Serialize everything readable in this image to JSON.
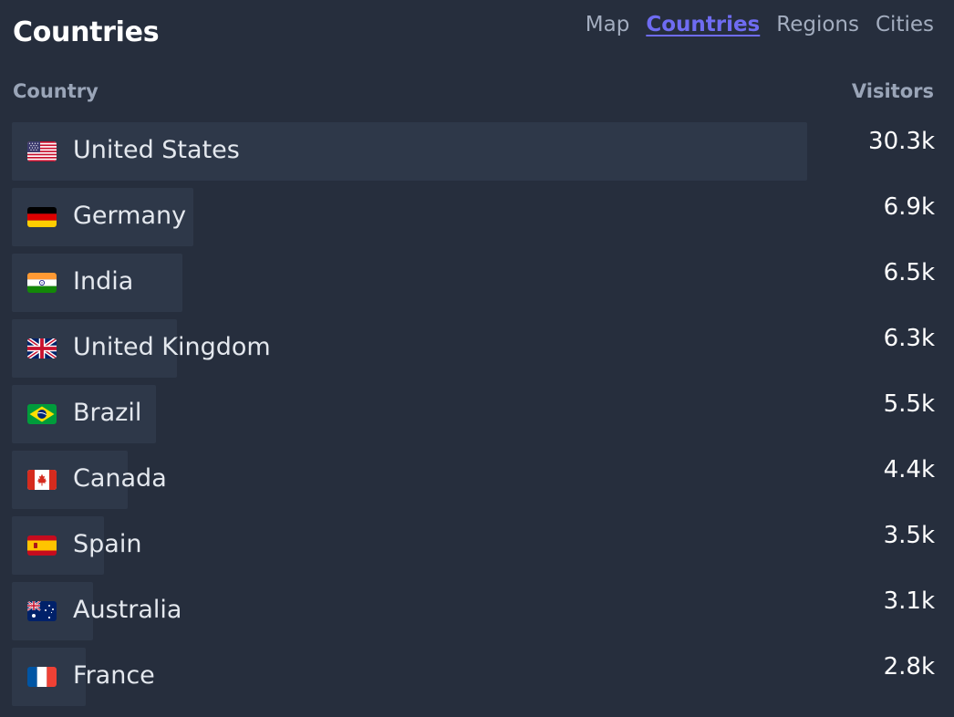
{
  "panel": {
    "title": "Countries",
    "tabs": [
      {
        "label": "Map",
        "active": false
      },
      {
        "label": "Countries",
        "active": true
      },
      {
        "label": "Regions",
        "active": false
      },
      {
        "label": "Cities",
        "active": false
      }
    ],
    "columns": {
      "country": "Country",
      "visitors": "Visitors"
    }
  },
  "colors": {
    "background": "#262e3d",
    "bar": "#2e3849",
    "active_tab": "#6f6cf2",
    "muted_text": "#a3adbf"
  },
  "rows": [
    {
      "name": "United States",
      "visitors": "30.3k",
      "visitors_num": 30300,
      "flag": "us-flag-icon"
    },
    {
      "name": "Germany",
      "visitors": "6.9k",
      "visitors_num": 6900,
      "flag": "de-flag-icon"
    },
    {
      "name": "India",
      "visitors": "6.5k",
      "visitors_num": 6500,
      "flag": "in-flag-icon"
    },
    {
      "name": "United Kingdom",
      "visitors": "6.3k",
      "visitors_num": 6300,
      "flag": "gb-flag-icon"
    },
    {
      "name": "Brazil",
      "visitors": "5.5k",
      "visitors_num": 5500,
      "flag": "br-flag-icon"
    },
    {
      "name": "Canada",
      "visitors": "4.4k",
      "visitors_num": 4400,
      "flag": "ca-flag-icon"
    },
    {
      "name": "Spain",
      "visitors": "3.5k",
      "visitors_num": 3500,
      "flag": "es-flag-icon"
    },
    {
      "name": "Australia",
      "visitors": "3.1k",
      "visitors_num": 3100,
      "flag": "au-flag-icon"
    },
    {
      "name": "France",
      "visitors": "2.8k",
      "visitors_num": 2800,
      "flag": "fr-flag-icon"
    }
  ]
}
